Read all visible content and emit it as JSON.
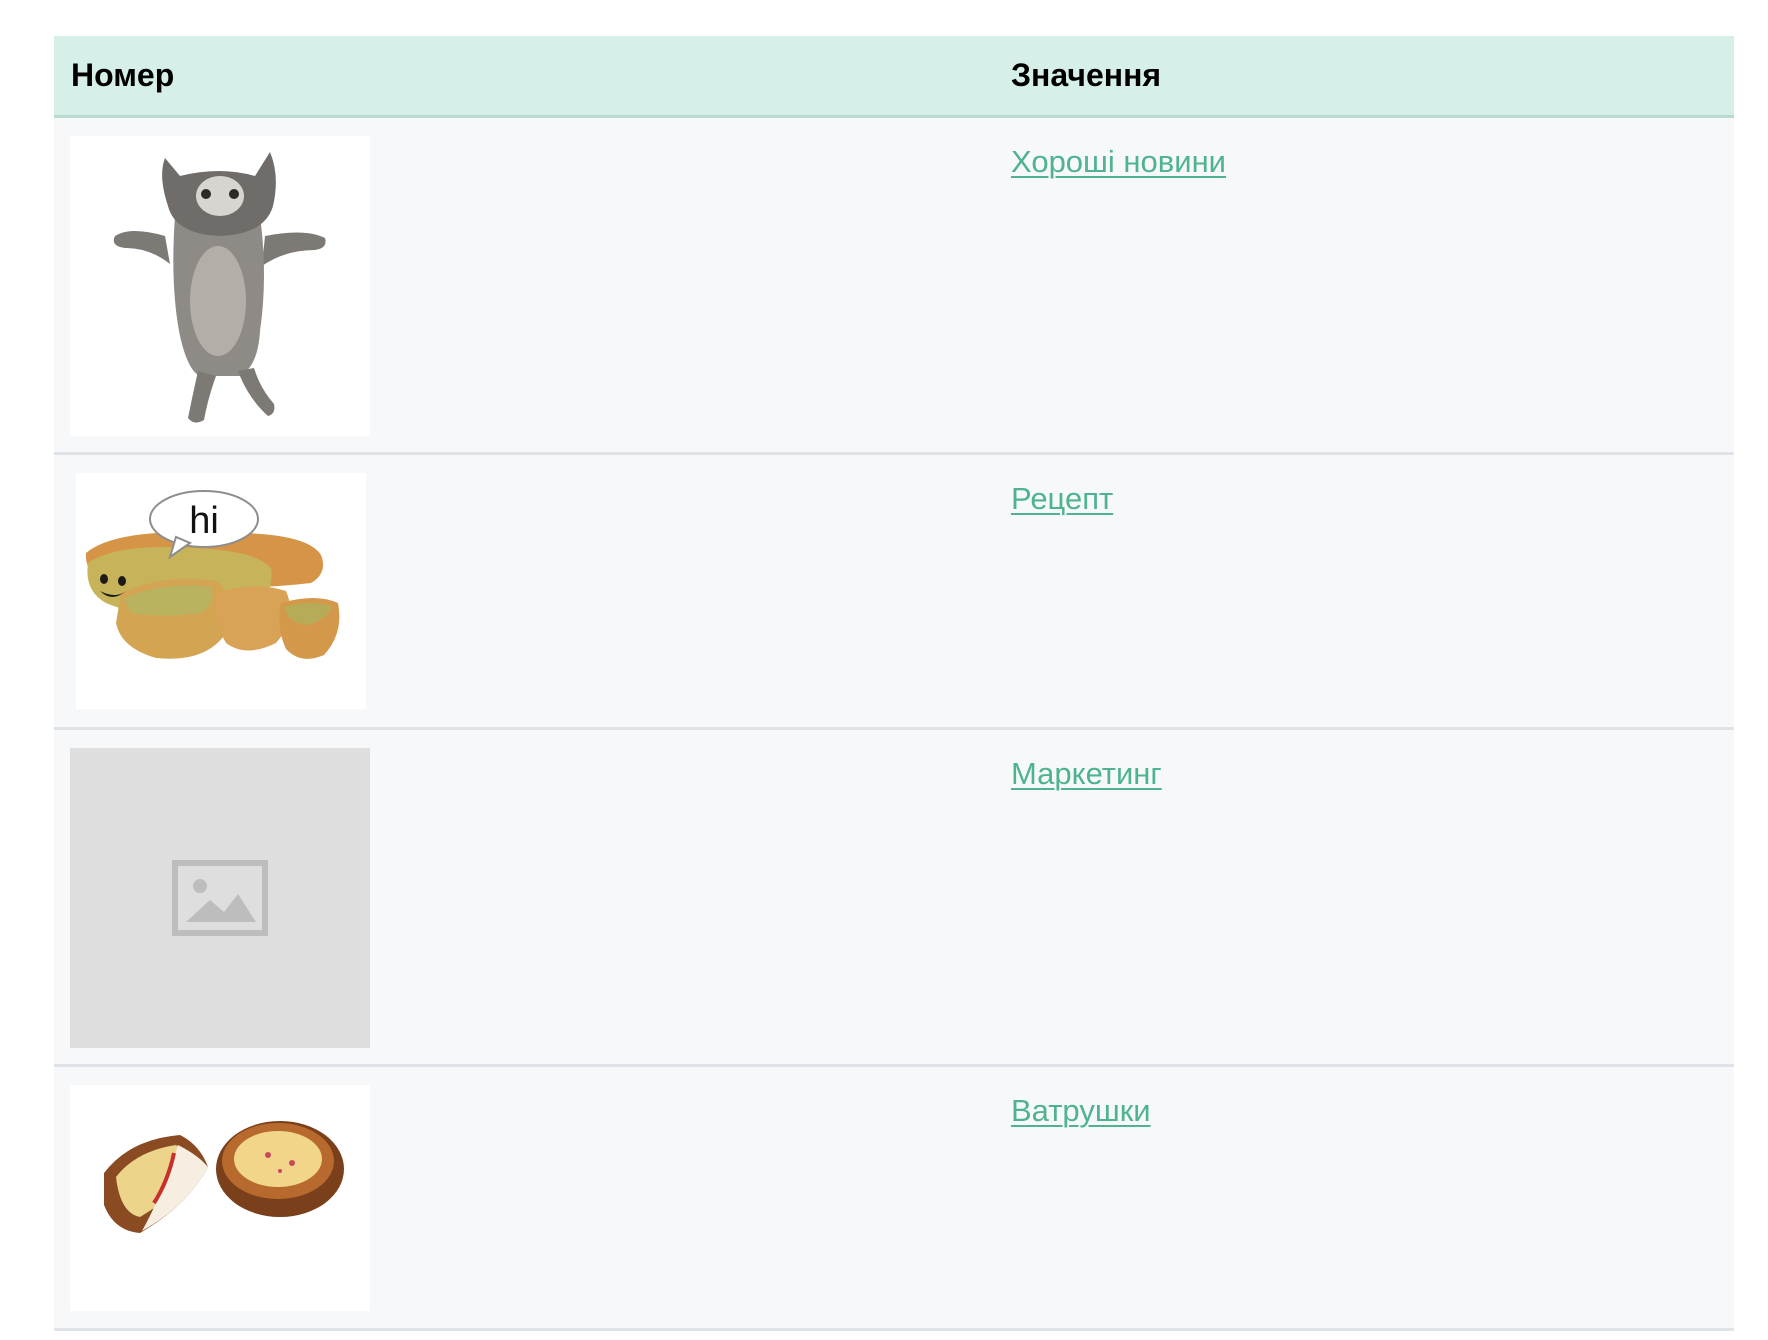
{
  "table": {
    "headers": {
      "number": "Номер",
      "value": "Значення"
    },
    "rows": [
      {
        "image": "dancing-cat-image",
        "link": "Хороші новини"
      },
      {
        "image": "garlic-bread-hi-image",
        "link": "Рецепт",
        "speech_bubble": "hi"
      },
      {
        "image": "image-placeholder-icon",
        "link": "Маркетинг"
      },
      {
        "image": "vatrushka-pastries-image",
        "link": "Ватрушки"
      }
    ]
  },
  "colors": {
    "header_bg": "#d6f0e9",
    "row_bg": "#f7f8fa",
    "link": "#4fb391",
    "placeholder_bg": "#dedede"
  }
}
